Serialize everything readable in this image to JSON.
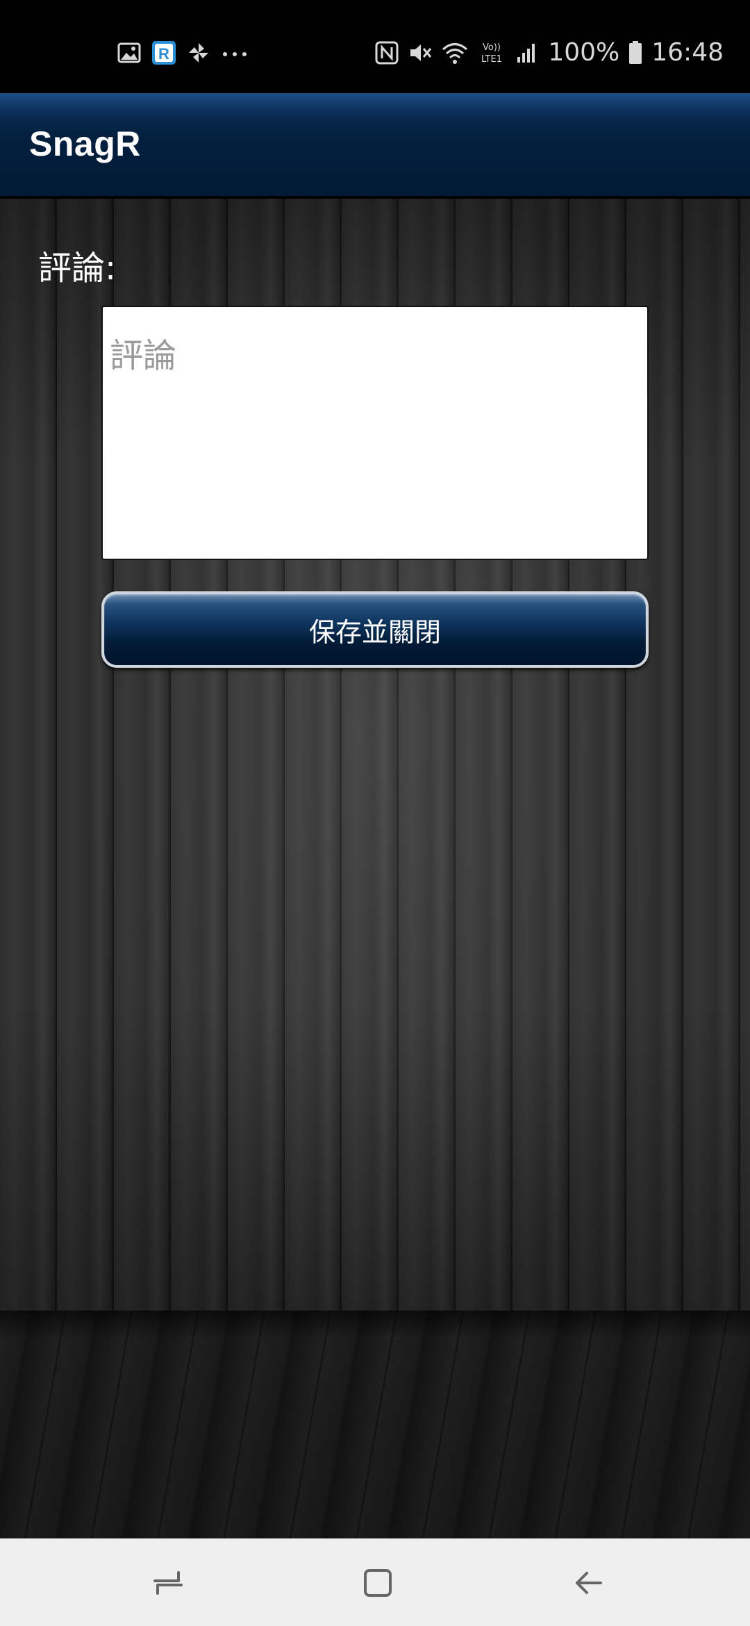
{
  "status_bar": {
    "left_icons": [
      "gallery-icon",
      "r-app-icon",
      "pinwheel-icon",
      "more-dots-icon"
    ],
    "right_icons": [
      "nfc-icon",
      "mute-icon",
      "wifi-icon",
      "volte-lte-icon",
      "signal-icon",
      "battery-icon"
    ],
    "network_label": "Vo)) LTE1",
    "battery": "100%",
    "time": "16:48"
  },
  "app_bar": {
    "title": "SnagR"
  },
  "form": {
    "comment_label": "評論:",
    "comment_placeholder": "評論",
    "comment_value": "",
    "save_button_label": "保存並關閉"
  },
  "nav_bar": {
    "buttons": [
      "recent-apps-icon",
      "home-icon",
      "back-icon"
    ]
  },
  "colors": {
    "app_bar": "#021a34",
    "button": "#0f355f",
    "nav_bar": "#efefef"
  }
}
